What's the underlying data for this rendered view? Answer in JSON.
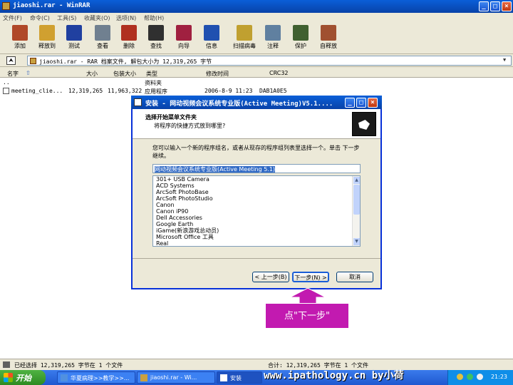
{
  "window": {
    "title": "jiaoshi.rar - WinRAR",
    "minimize": "_",
    "maximize": "□",
    "close": "×"
  },
  "menu": [
    "文件(F)",
    "命令(C)",
    "工具(S)",
    "收藏夹(O)",
    "选项(N)",
    "帮助(H)"
  ],
  "toolbar": [
    {
      "label": "添加",
      "icon": "add-icon",
      "color": "#b04828"
    },
    {
      "label": "释放到",
      "icon": "extract-to-icon",
      "color": "#d0a030"
    },
    {
      "label": "测试",
      "icon": "test-icon",
      "color": "#2040a0"
    },
    {
      "label": "查看",
      "icon": "view-icon",
      "color": "#708090"
    },
    {
      "label": "删除",
      "icon": "delete-icon",
      "color": "#b03020"
    },
    {
      "label": "查找",
      "icon": "find-icon",
      "color": "#303030"
    },
    {
      "label": "向导",
      "icon": "wizard-icon",
      "color": "#a02040"
    },
    {
      "label": "信息",
      "icon": "info-icon",
      "color": "#2050b0"
    },
    {
      "label": "扫描病毒",
      "icon": "virus-scan-icon",
      "color": "#c0a030"
    },
    {
      "label": "注释",
      "icon": "comment-icon",
      "color": "#6080a0"
    },
    {
      "label": "保护",
      "icon": "protect-icon",
      "color": "#406030"
    },
    {
      "label": "自释放",
      "icon": "sfx-icon",
      "color": "#a05030"
    }
  ],
  "address": {
    "text": "jiaoshi.rar - RAR 档案文件, 解包大小为 12,319,265 字节"
  },
  "columns": [
    "名字",
    "大小",
    "包装大小",
    "类型",
    "修改时间",
    "CRC32"
  ],
  "rows": [
    {
      "name": "..",
      "size": "",
      "packed": "",
      "type": "资料夹",
      "modified": "",
      "crc": ""
    },
    {
      "name": "meeting_clie...",
      "size": "12,319,265",
      "packed": "11,963,322",
      "type": "应用程序",
      "modified": "2006-8-9 11:23",
      "crc": "DAB1A0E5"
    }
  ],
  "status": {
    "left": "已经选择 12,319,265 字节在 1 个文件",
    "right": "合计: 12,319,265 字节在 1 个文件"
  },
  "dialog": {
    "title": "安装 - 网动视频会议系统专业版(Active Meeting)V5.1....",
    "heading": "选择开始菜单文件夹",
    "subheading": "将程序的快捷方式放到哪里?",
    "instructions": "您可以输入一个新的程序组名，或者从现存的程序组列表里选择一个。单击 下一步 继续。",
    "group_value": "网动视频会议系统专业版(Active Meeting 5.1)",
    "groups": [
      "301+ USB Camera",
      "ACD Systems",
      "ArcSoft PhotoBase",
      "ArcSoft PhotoStudio",
      "Canon",
      "Canon iP90",
      "Dell Accessories",
      "Google Earth",
      "iGame(新浪游戏总动员)",
      "Microsoft Office 工具",
      "Real"
    ],
    "back_button": "< 上一步(B)",
    "next_button": "下一步(N) >",
    "cancel_button": "取消"
  },
  "annotation": {
    "callout": "点\"下一步\""
  },
  "taskbar": {
    "start": "开始",
    "tasks": [
      "华夏病理>>教学>>...",
      "jiaoshi.rar - Wi...",
      "安装"
    ],
    "clock": "21:23"
  },
  "watermark": "www.ipathology.cn  by小荷",
  "colors": {
    "xp_blue": "#0842a8",
    "callout_magenta": "#c21ab0",
    "start_green": "#2e8a22"
  }
}
